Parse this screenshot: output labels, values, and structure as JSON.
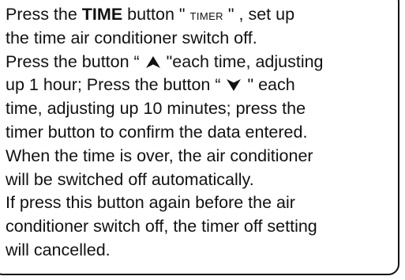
{
  "instructions": {
    "line1": {
      "pre": "Press the ",
      "time_bold": "TIME",
      "mid": " button \" ",
      "timer_label": "TIMER",
      "post": " \" , set up"
    },
    "line2": "the time air conditioner switch off.",
    "line3": {
      "pre": "Press the button “ ",
      "post": " \"each time, adjusting"
    },
    "line4": {
      "pre": "up 1 hour;  Press the button “ ",
      "post": " \" each"
    },
    "line5": "time, adjusting up 10 minutes; press the",
    "line6": "timer button to confirm the data entered.",
    "line7": "When the time is over, the air conditioner",
    "line8": "will be switched off automatically.",
    "line9": "If press this button again before the air",
    "line10": "conditioner switch off, the timer off setting",
    "line11": "will cancelled."
  },
  "icons": {
    "up": "up-arrow-icon",
    "down": "down-arrow-icon"
  },
  "colors": {
    "text": "#111111",
    "border": "#111111",
    "background": "#ffffff"
  }
}
